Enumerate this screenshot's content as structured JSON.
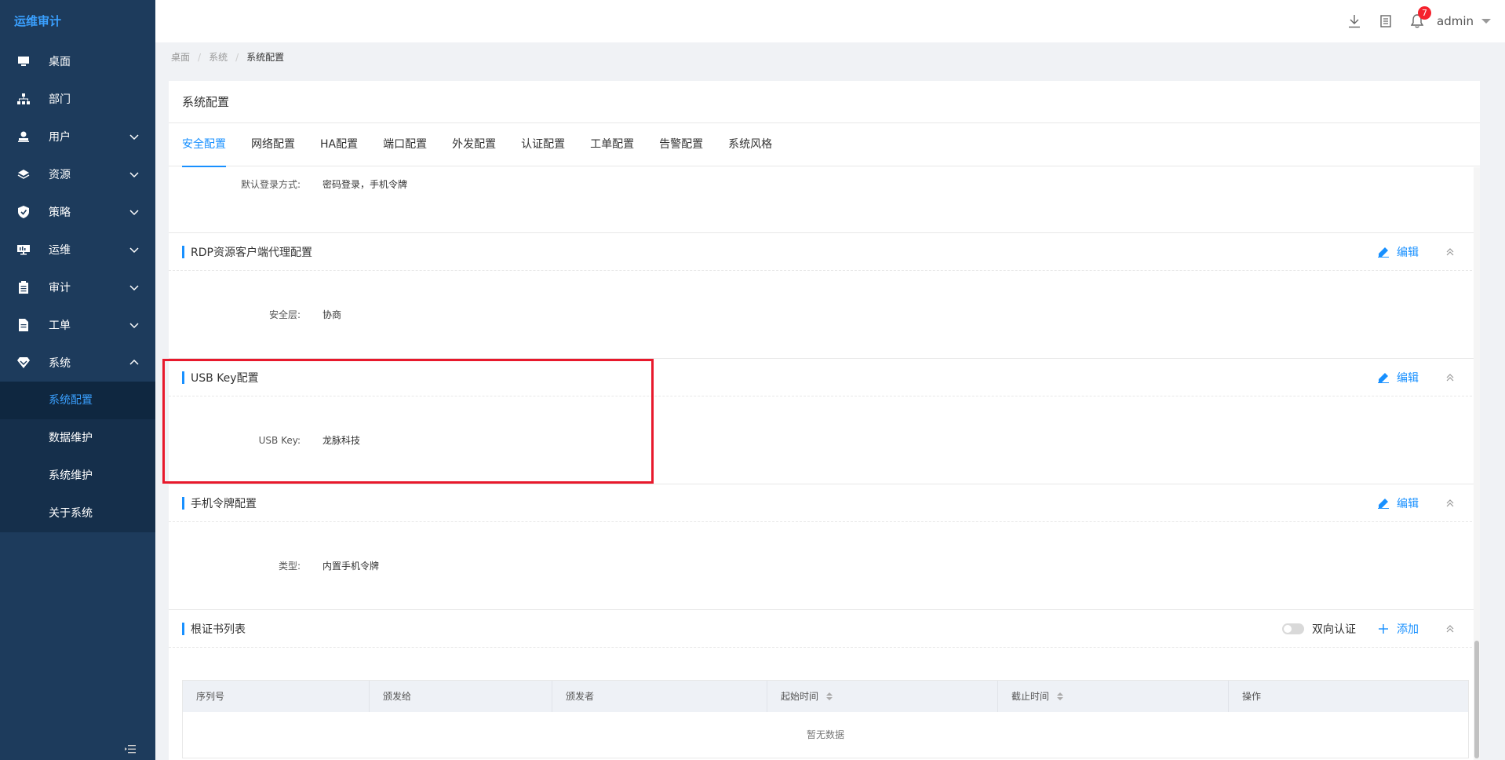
{
  "app": {
    "title": "运维审计"
  },
  "sidebar": {
    "items": [
      {
        "label": "桌面",
        "icon": "desktop-icon",
        "expandable": false
      },
      {
        "label": "部门",
        "icon": "org-tree-icon",
        "expandable": false
      },
      {
        "label": "用户",
        "icon": "user-icon",
        "expandable": true
      },
      {
        "label": "资源",
        "icon": "layers-icon",
        "expandable": true
      },
      {
        "label": "策略",
        "icon": "shield-icon",
        "expandable": true
      },
      {
        "label": "运维",
        "icon": "monitor-icon",
        "expandable": true
      },
      {
        "label": "审计",
        "icon": "clipboard-icon",
        "expandable": true
      },
      {
        "label": "工单",
        "icon": "document-icon",
        "expandable": true
      },
      {
        "label": "系统",
        "icon": "diamond-icon",
        "expandable": true,
        "expanded": true
      }
    ],
    "sub_items": [
      {
        "label": "系统配置",
        "active": true
      },
      {
        "label": "数据维护"
      },
      {
        "label": "系统维护"
      },
      {
        "label": "关于系统"
      }
    ]
  },
  "header": {
    "notification_count": "7",
    "username": "admin"
  },
  "breadcrumb": [
    "桌面",
    "系统",
    "系统配置"
  ],
  "page": {
    "title": "系统配置",
    "tabs": [
      "安全配置",
      "网络配置",
      "HA配置",
      "端口配置",
      "外发配置",
      "认证配置",
      "工单配置",
      "告警配置",
      "系统风格"
    ],
    "active_tab": "安全配置"
  },
  "login": {
    "label": "默认登录方式:",
    "value": "密码登录，手机令牌"
  },
  "sections": {
    "rdp": {
      "title": "RDP资源客户端代理配置",
      "edit": "编辑",
      "field_label": "安全层:",
      "field_value": "协商"
    },
    "usbkey": {
      "title": "USB Key配置",
      "edit": "编辑",
      "field_label": "USB Key:",
      "field_value": "龙脉科技"
    },
    "mobile": {
      "title": "手机令牌配置",
      "edit": "编辑",
      "field_label": "类型:",
      "field_value": "内置手机令牌"
    },
    "rootcert": {
      "title": "根证书列表",
      "toggle_label": "双向认证",
      "add": "添加",
      "columns": [
        "序列号",
        "颁发给",
        "颁发者",
        "起始时间",
        "截止时间",
        "操作"
      ],
      "empty_text": "暂无数据"
    }
  },
  "colors": {
    "sidebar_bg": "#1d3b5c",
    "accent": "#1890ff",
    "highlight": "#e8192c"
  }
}
